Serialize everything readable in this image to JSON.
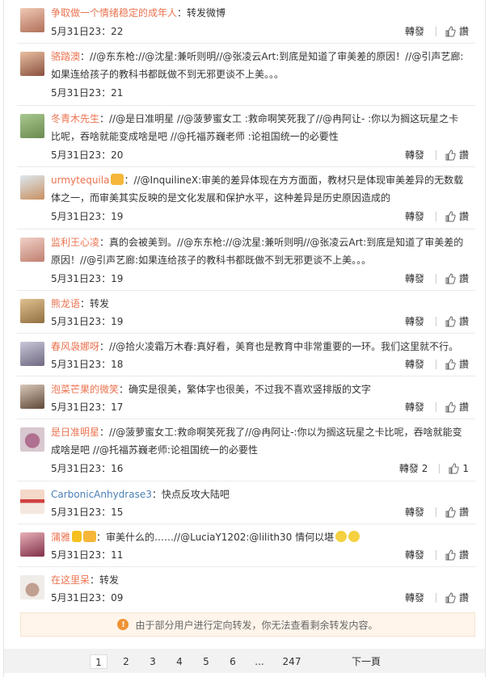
{
  "ui": {
    "forward_label": "轉發",
    "like_label": "讚"
  },
  "items": [
    {
      "user": "争取做一个情绪稳定的成年人",
      "text": "：转发微博",
      "time": "5月31日23：22"
    },
    {
      "user": "骆踏澳",
      "text": "：//@东东枪://@沈星:兼听则明//@张凌云Art:到底是知道了审美差的原因！//@引声艺廊:如果连给孩子的教科书都既做不到无邪更谈不上美。。。",
      "time": "5月31日23：21"
    },
    {
      "user": "冬青木先生",
      "text": "：//@是日准明星 //@菠萝蜜女工 :救命啊笑死我了//@冉阿让- :你以为搁这玩星之卡比呢，吞啥就能变成啥是吧 //@托福苏巍老师 :论祖国统一的必要性",
      "time": "5月31日23：20"
    },
    {
      "user": "urmytequila",
      "text": "：//@InquilineX:审美的差异体现在方方面面，教材只是体现审美差异的无数载体之一，而审美其实反映的是文化发展和保护水平，这种差异是历史原因造成的",
      "time": "5月31日23：19"
    },
    {
      "user": "监利王心凌",
      "text": "：真的会被美到。//@东东枪://@沈星:兼听则明//@张凌云Art:到底是知道了审美差的原因！//@引声艺廊:如果连给孩子的教科书都既做不到无邪更谈不上美。。。",
      "time": "5月31日23：19"
    },
    {
      "user": "熊龙语",
      "text": "：转发",
      "time": "5月31日23：19"
    },
    {
      "user": "春风袅娜呀",
      "text": "：//@拾火凌霜万木春:真好看，美育也是教育中非常重要的一环。我们这里就不行。",
      "time": "5月31日23：18"
    },
    {
      "user": "泡菜芒果的微笑",
      "text": "：确实是很美，繁体字也很美，不过我不喜欢竖排版的文字",
      "time": "5月31日23：17"
    },
    {
      "user": "是日准明星",
      "text": "：//@菠萝蜜女工:救命啊笑死我了//@冉阿让-:你以为搁这玩星之卡比呢，吞啥就能变成啥是吧 //@托福苏巍老师:论祖国统一的必要性",
      "time": "5月31日23：16",
      "forwards": "2",
      "likes": "1"
    },
    {
      "user": "CarbonicAnhydrase3",
      "text": "：快点反攻大陆吧",
      "time": "5月31日23：15"
    },
    {
      "user": "蒲雅",
      "text": "：审美什么的……//@LuciaY1202:@lilith30 情何以堪",
      "time": "5月31日23：11"
    },
    {
      "user": "在这里呆",
      "text": "：转发",
      "time": "5月31日23：09"
    }
  ],
  "notice": "由于部分用户进行定向转发，你无法查看剩余转发内容。",
  "pager": {
    "pages": [
      "1",
      "2",
      "3",
      "4",
      "5",
      "6",
      "...",
      "247"
    ],
    "next": "下一頁"
  },
  "colors": {
    "username": "#eb7350",
    "link": "#4a7fb5",
    "notice_bg": "#fff5eb",
    "notice_icon": "#ef9334"
  }
}
